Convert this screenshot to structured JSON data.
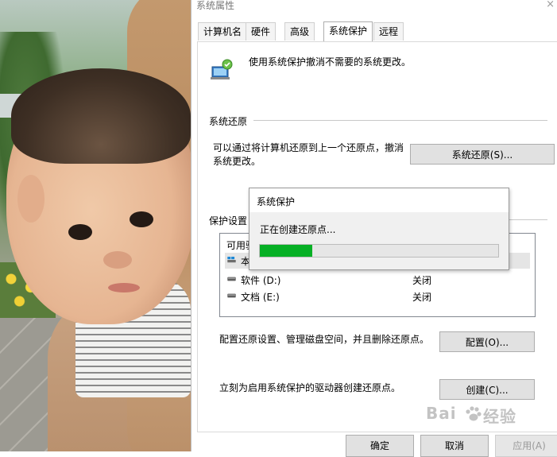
{
  "window": {
    "title": "系统属性",
    "close_glyph": "×"
  },
  "tabs": [
    {
      "label": "计算机名",
      "active": false
    },
    {
      "label": "硬件",
      "active": false
    },
    {
      "label": "高级",
      "active": false
    },
    {
      "label": "系统保护",
      "active": true
    },
    {
      "label": "远程",
      "active": false
    }
  ],
  "protection": {
    "intro_text": "使用系统保护撤消不需要的系统更改。",
    "restore_section_label": "系统还原",
    "restore_description": "可以通过将计算机还原到上一个还原点，撤消系统更改。",
    "restore_button": "系统还原(S)...",
    "settings_section_label": "保护设置",
    "list_header_partial": "可用驱",
    "drives": [
      {
        "name": "本",
        "status": "",
        "icon": "windows-drive-icon",
        "selected": true
      },
      {
        "name": "软件 (D:)",
        "status": "关闭",
        "icon": "drive-icon",
        "selected": false
      },
      {
        "name": "文档 (E:)",
        "status": "关闭",
        "icon": "drive-icon",
        "selected": false
      }
    ],
    "configure_text": "配置还原设置、管理磁盘空间，并且删除还原点。",
    "configure_button": "配置(O)...",
    "create_text": "立刻为启用系统保护的驱动器创建还原点。",
    "create_button": "创建(C)..."
  },
  "footer": {
    "ok_label": "确定",
    "cancel_label": "取消",
    "apply_label": "应用(A)"
  },
  "progress_dialog": {
    "title": "系统保护",
    "message": "正在创建还原点...",
    "progress_fraction": 0.22,
    "fill_color": "#06b025"
  },
  "watermark": {
    "text_left": "Bai",
    "text_right": "经验"
  }
}
